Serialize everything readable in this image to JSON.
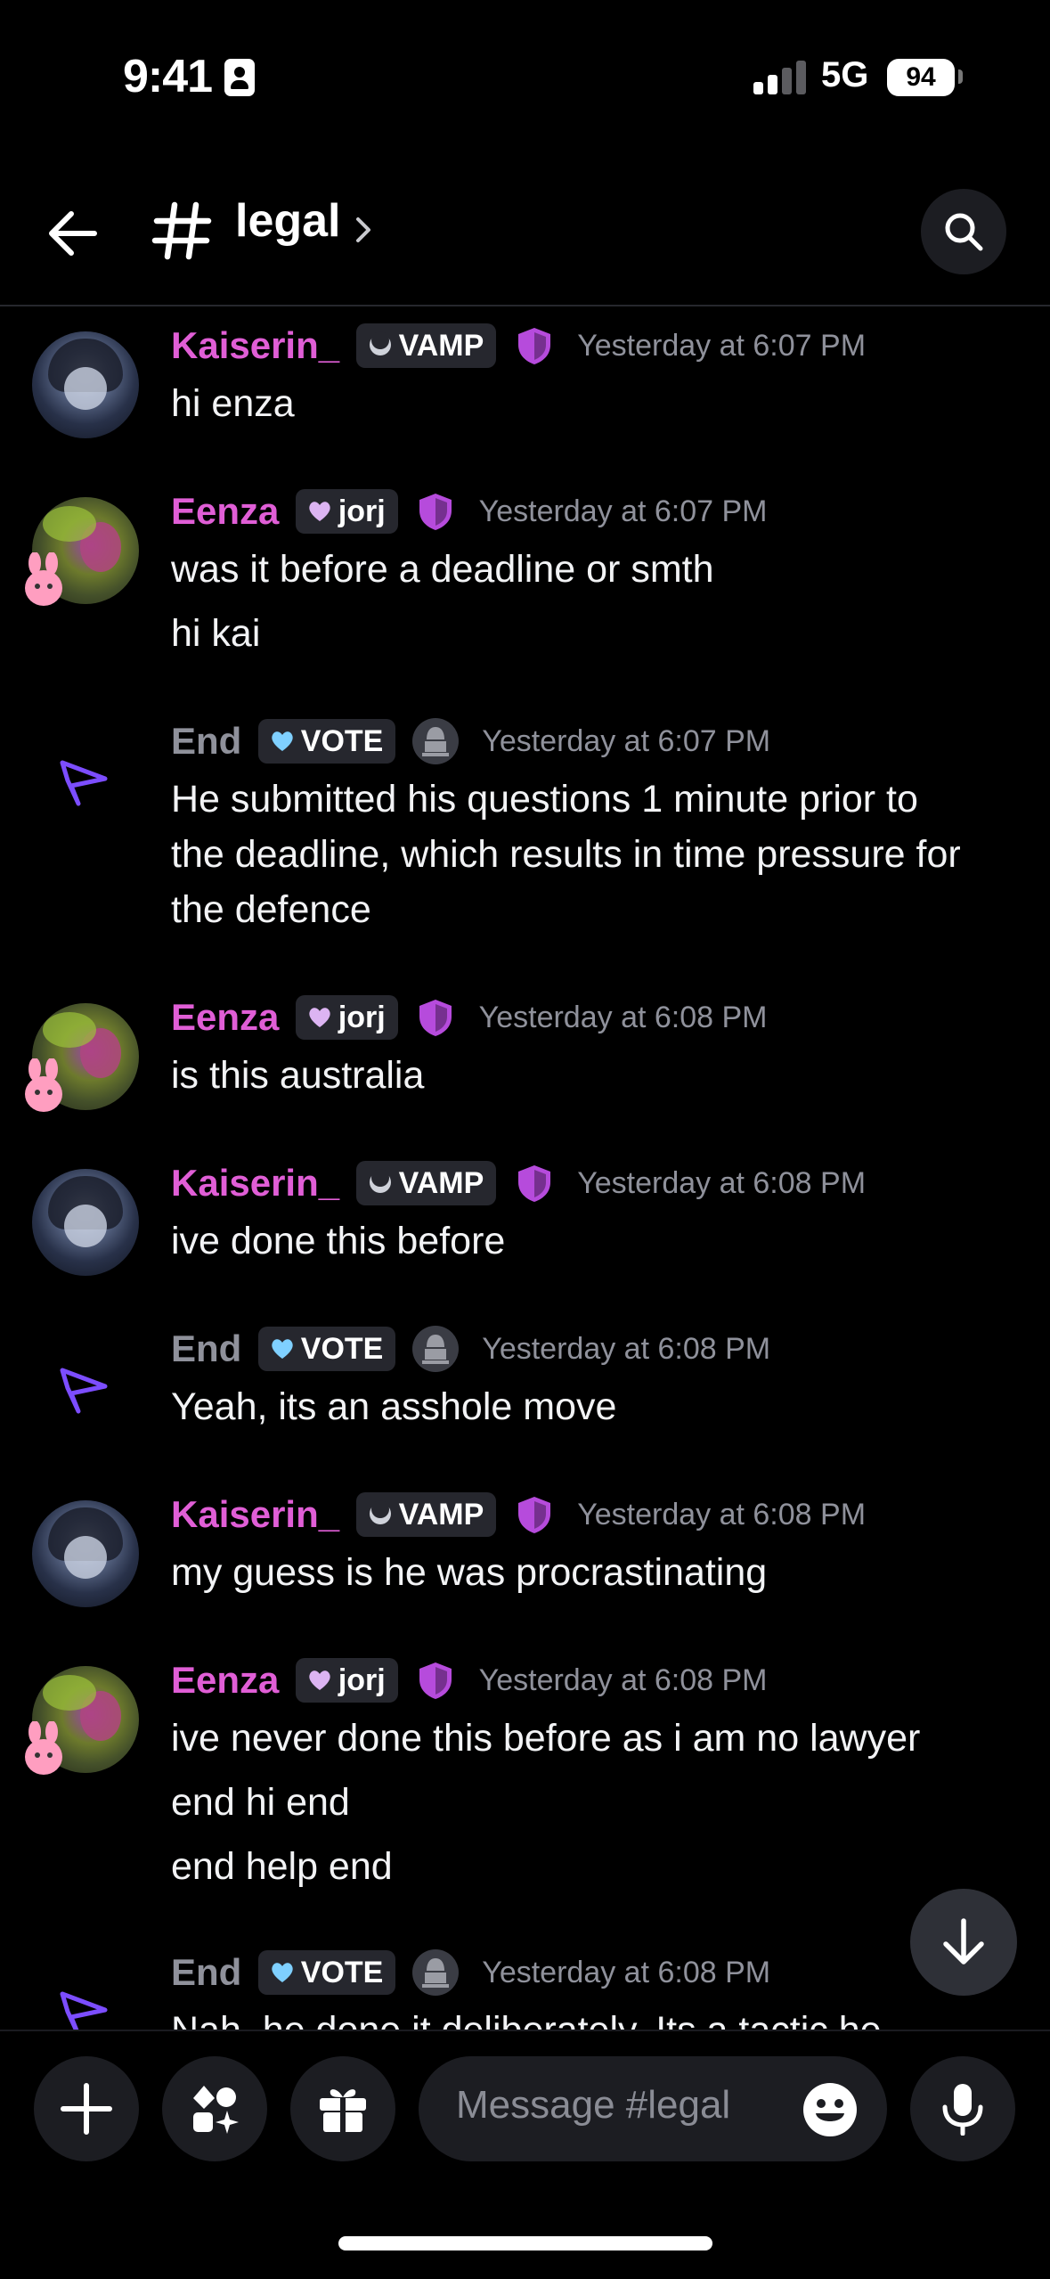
{
  "status_bar": {
    "time": "9:41",
    "network": "5G",
    "battery": "94"
  },
  "header": {
    "channel_name": "legal"
  },
  "tags": {
    "kaiserin": "VAMP",
    "eenza": "jorj",
    "end": "VOTE"
  },
  "messages": [
    {
      "author": "Kaiserin_",
      "time": "Yesterday at 6:07 PM",
      "lines": [
        "hi enza"
      ]
    },
    {
      "author": "Eenza",
      "time": "Yesterday at 6:07 PM",
      "lines": [
        "was it before a deadline or smth",
        "hi kai"
      ]
    },
    {
      "author": "End",
      "time": "Yesterday at 6:07 PM",
      "lines": [
        "He submitted his questions 1 minute prior to",
        "the deadline, which results in time pressure for",
        "the defence"
      ]
    },
    {
      "author": "Eenza",
      "time": "Yesterday at 6:08 PM",
      "lines": [
        "is this australia"
      ]
    },
    {
      "author": "Kaiserin_",
      "time": "Yesterday at 6:08 PM",
      "lines": [
        "ive done this before"
      ]
    },
    {
      "author": "End",
      "time": "Yesterday at 6:08 PM",
      "lines": [
        "Yeah, its an asshole move"
      ]
    },
    {
      "author": "Kaiserin_",
      "time": "Yesterday at 6:08 PM",
      "lines": [
        "my guess is he was procrastinating"
      ]
    },
    {
      "author": "Eenza",
      "time": "Yesterday at 6:08 PM",
      "lines": [
        "ive never done this before as i am no lawyer",
        "end hi end",
        "end help end"
      ]
    },
    {
      "author": "End",
      "time": "Yesterday at 6:08 PM",
      "lines": [
        "Nah, he done it deliberately. Its a tactic he"
      ]
    }
  ],
  "composer": {
    "placeholder": "Message #legal"
  },
  "colors": {
    "background": "#000000",
    "username_pink": "#e05ed6",
    "username_grey": "#8f919b",
    "shield_purple": "#b64bdc",
    "bot_purple": "#7c4dff"
  }
}
